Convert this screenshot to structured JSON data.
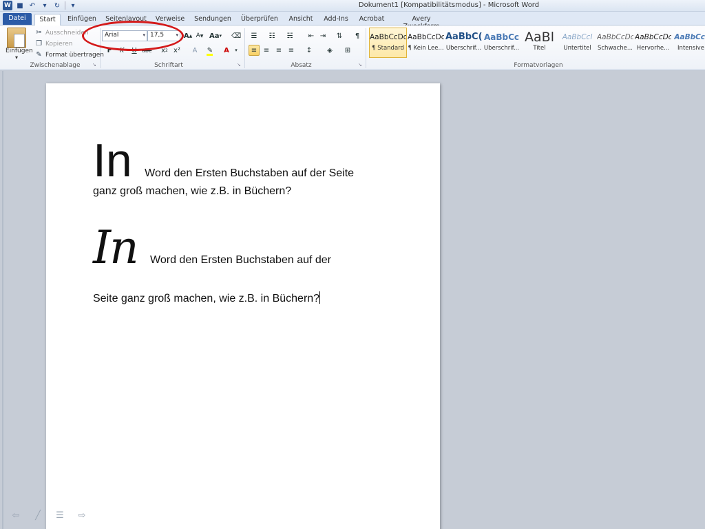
{
  "window": {
    "title": "Dokument1 [Kompatibilitätsmodus]  -  Microsoft Word"
  },
  "tabs": [
    {
      "label": "Datei"
    },
    {
      "label": "Start"
    },
    {
      "label": "Einfügen"
    },
    {
      "label": "Seitenlayout"
    },
    {
      "label": "Verweise"
    },
    {
      "label": "Sendungen"
    },
    {
      "label": "Überprüfen"
    },
    {
      "label": "Ansicht"
    },
    {
      "label": "Add-Ins"
    },
    {
      "label": "Acrobat"
    },
    {
      "label": "Avery Zweckform"
    }
  ],
  "clipboard": {
    "paste_label": "Einfügen",
    "cut_label": "Ausschneiden",
    "copy_label": "Kopieren",
    "format_painter_label": "Format übertragen",
    "group_label": "Zwischenablage"
  },
  "font": {
    "font_name": "Arial",
    "font_size": "17,5",
    "grow_label": "A",
    "shrink_label": "A",
    "case_label": "Aa",
    "bold_label": "F",
    "italic_label": "K",
    "underline_label": "U",
    "strike_label": "abc",
    "subscript_label": "x",
    "superscript_label": "x²",
    "color_label": "A",
    "group_label": "Schriftart"
  },
  "paragraph": {
    "group_label": "Absatz"
  },
  "styles": {
    "group_label": "Formatvorlagen",
    "items": [
      {
        "sample": "AaBbCcDc",
        "name": "¶ Standard"
      },
      {
        "sample": "AaBbCcDc",
        "name": "¶ Kein Lee..."
      },
      {
        "sample": "AaBbC(",
        "name": "Überschrif..."
      },
      {
        "sample": "AaBbCc",
        "name": "Überschrif..."
      },
      {
        "sample": "AaBl",
        "name": "Titel"
      },
      {
        "sample": "AaBbCcl",
        "name": "Untertitel"
      },
      {
        "sample": "AaBbCcDc",
        "name": "Schwache..."
      },
      {
        "sample": "AaBbCcDc",
        "name": "Hervorhe..."
      },
      {
        "sample": "AaBbCcl",
        "name": "Intensive"
      }
    ]
  },
  "document": {
    "para1": {
      "dropcap": "In",
      "text_line1": "Word den Ersten Buchstaben auf der Seite",
      "text_line2": "ganz groß machen, wie z.B. in Büchern?"
    },
    "para2": {
      "dropcap": "In",
      "text_line1": "Word den Ersten Buchstaben auf der",
      "text_line2": "Seite ganz groß machen, wie z.B. in Büchern?"
    }
  }
}
